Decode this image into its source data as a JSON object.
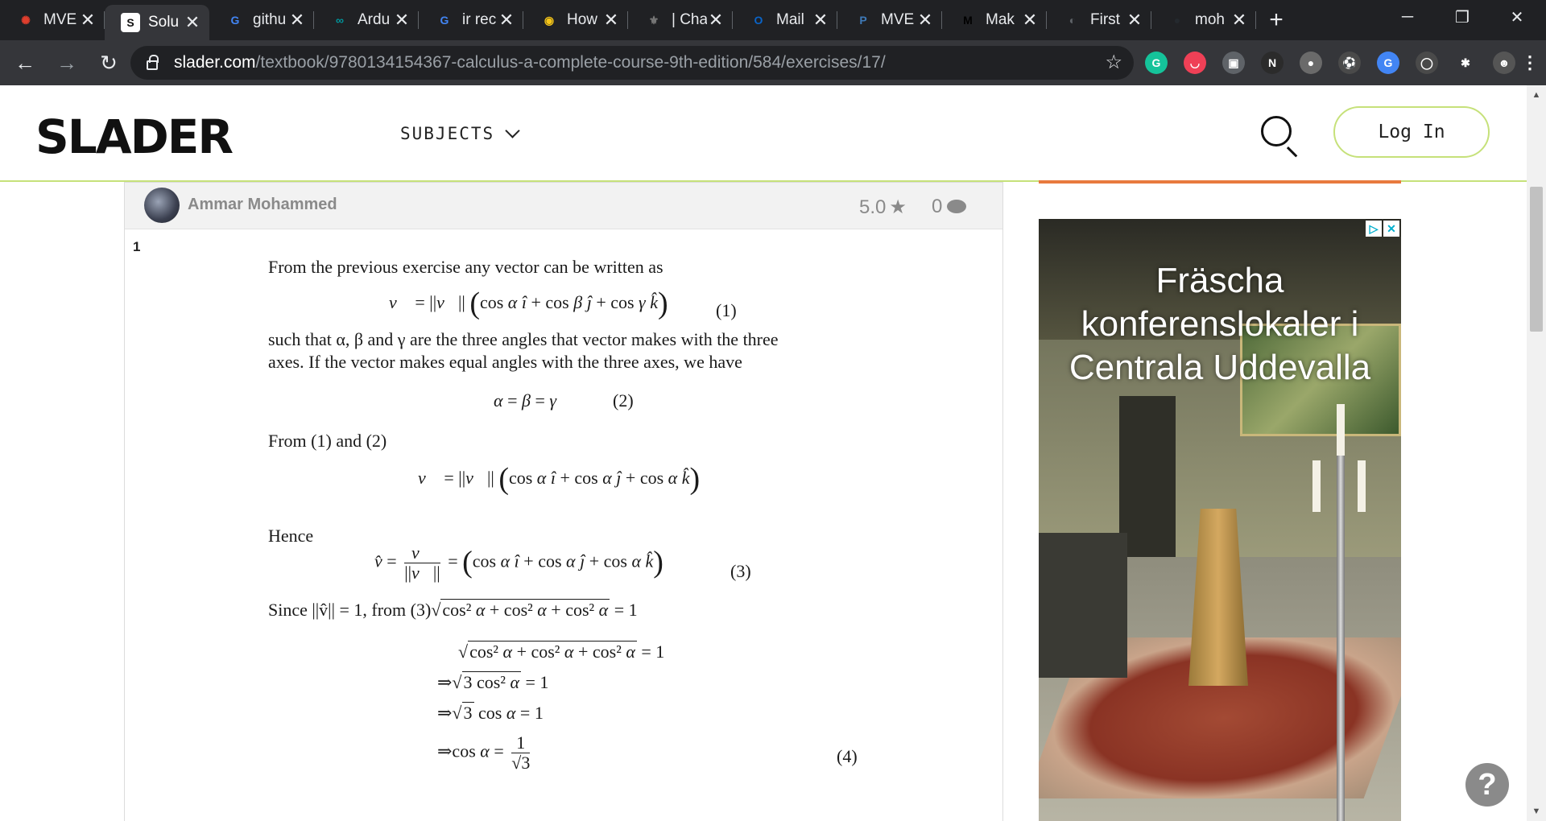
{
  "browser": {
    "tabs": [
      {
        "title": "MVE",
        "favicon": "canvas-icon",
        "color": "#e03e2d",
        "glyph": "✺"
      },
      {
        "title": "Solu",
        "favicon": "slader-icon",
        "color": "#111111",
        "glyph": "S",
        "active": true
      },
      {
        "title": "githu",
        "favicon": "google-icon",
        "color": "#4285f4",
        "glyph": "G"
      },
      {
        "title": "Ardu",
        "favicon": "arduino-icon",
        "color": "#00979d",
        "glyph": "∞"
      },
      {
        "title": "ir rec",
        "favicon": "google-icon",
        "color": "#4285f4",
        "glyph": "G"
      },
      {
        "title": "How",
        "favicon": "instructables-icon",
        "color": "#f5c518",
        "glyph": "◉"
      },
      {
        "title": "| Cha",
        "favicon": "university-icon",
        "color": "#777777",
        "glyph": "⚜"
      },
      {
        "title": "Mail",
        "favicon": "outlook-icon",
        "color": "#0a64c8",
        "glyph": "O"
      },
      {
        "title": "MVE",
        "favicon": "piazza-icon",
        "color": "#3e7ab8",
        "glyph": "P"
      },
      {
        "title": "Mak",
        "favicon": "medium-icon",
        "color": "#000000",
        "glyph": "M"
      },
      {
        "title": "First",
        "favicon": "globe-icon",
        "color": "#5f6368",
        "glyph": "◐"
      },
      {
        "title": "moh",
        "favicon": "github-icon",
        "color": "#24292e",
        "glyph": "●"
      }
    ],
    "new_tab": "+",
    "url_host": "slader.com",
    "url_path": "/textbook/9780134154367-calculus-a-complete-course-9th-edition/584/exercises/17/",
    "extensions": [
      {
        "name": "grammarly-icon",
        "color": "#15c39a",
        "glyph": "G"
      },
      {
        "name": "pocket-icon",
        "color": "#ef4056",
        "glyph": "◡"
      },
      {
        "name": "screenshot-icon",
        "color": "#5f6368",
        "glyph": "▣"
      },
      {
        "name": "n-extension-icon",
        "color": "#2b2b2b",
        "glyph": "N"
      },
      {
        "name": "account-icon",
        "color": "#6a6a6a",
        "glyph": "●"
      },
      {
        "name": "soccer-icon",
        "color": "#4a4a4a",
        "glyph": "⚽"
      },
      {
        "name": "translate-icon",
        "color": "#4285f4",
        "glyph": "G"
      },
      {
        "name": "circle-extension-icon",
        "color": "#4a4a4a",
        "glyph": "◯"
      },
      {
        "name": "puzzle-icon",
        "color": "#35363a",
        "glyph": "✱"
      },
      {
        "name": "profile-avatar-icon",
        "color": "#555555",
        "glyph": "☻"
      }
    ]
  },
  "site": {
    "logo": "SLADER",
    "subjects": "SUBJECTS",
    "login": "Log In"
  },
  "solution": {
    "author": "Ammar Mohammed",
    "rating": "5.0",
    "comments": "0",
    "step": "1",
    "lines": {
      "intro": "From the previous exercise any vector can be written as",
      "such_that_1": "such that α, β and γ are the three angles that vector makes with the three",
      "such_that_2": "axes. If the vector makes equal angles with the three axes, we have",
      "from12": "From (1) and (2)",
      "hence": "Hence",
      "since_prefix": "Since ||v̂|| = 1, from (3)",
      "eq1_no": "(1)",
      "eq2_no": "(2)",
      "eq3_no": "(3)",
      "eq4_no": "(4)"
    }
  },
  "ad": {
    "headline_1": "Fräscha",
    "headline_2": "konferenslokaler i",
    "headline_3": "Centrala Uddevalla",
    "badge_play": "▷",
    "badge_close": "✕"
  },
  "help_button": "?"
}
